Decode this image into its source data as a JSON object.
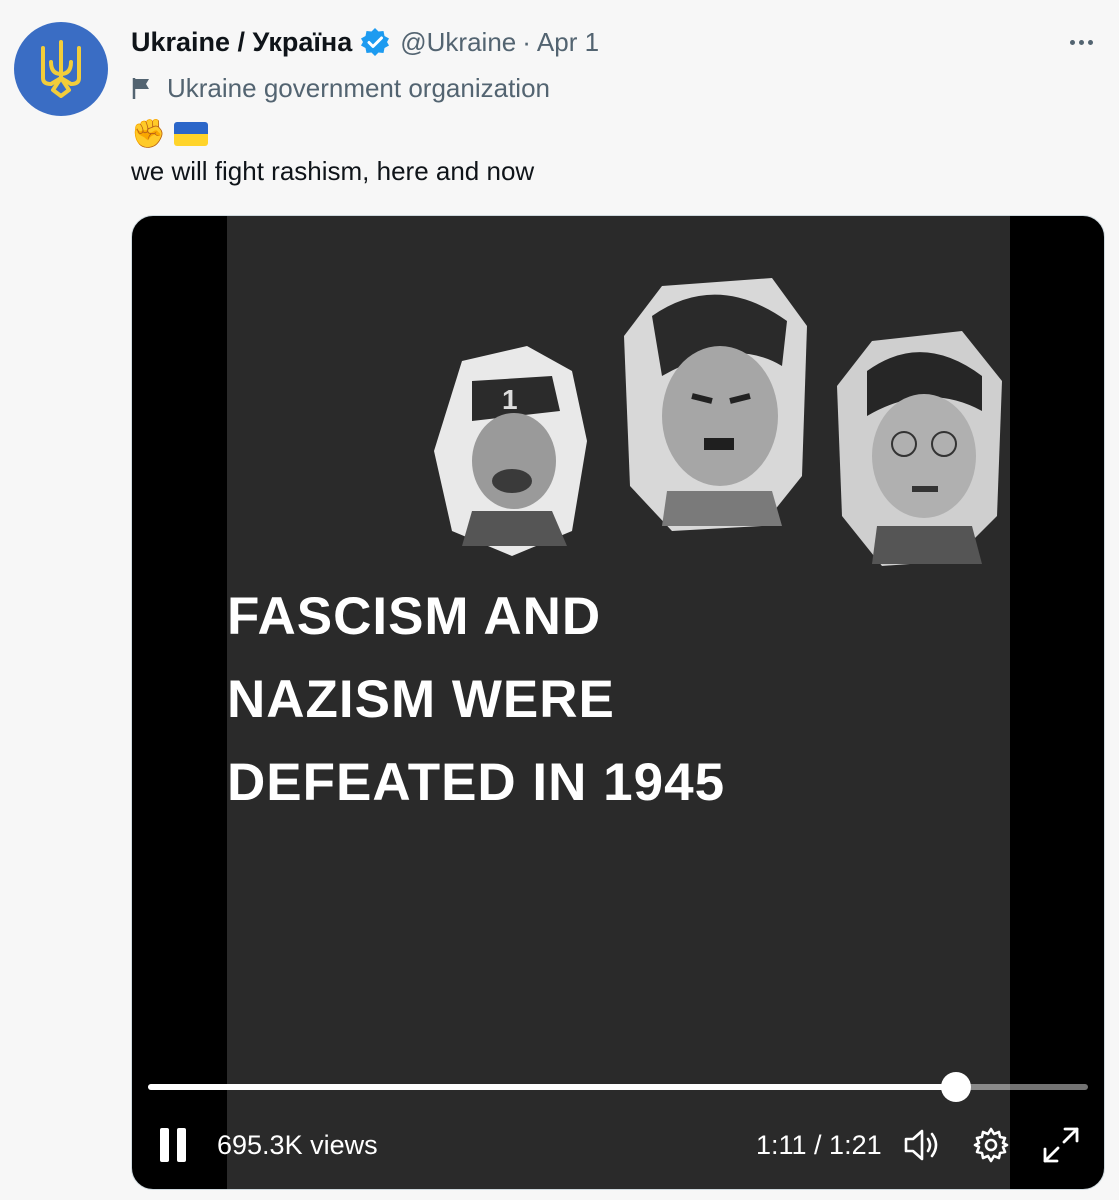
{
  "author": {
    "display_name": "Ukraine / Україна",
    "handle": "@Ukraine",
    "separator": "·",
    "date": "Apr 1",
    "verified": true,
    "label": "Ukraine government organization",
    "avatar_colors": {
      "background": "#3a6dc4",
      "emblem": "#f2cd3a"
    }
  },
  "tweet": {
    "emojis": [
      "fist-emoji",
      "ukraine-flag-emoji"
    ],
    "fist_glyph": "✊",
    "text": "we will fight rashism, here and now"
  },
  "video": {
    "caption": "FASCISM AND\nNAZISM WERE\nDEFEATED IN 1945",
    "views": "695.3K views",
    "time": "1:11 / 1:21",
    "progress_fraction": 0.86,
    "controls": [
      "pause-icon",
      "volume-icon",
      "settings-gear-icon",
      "fullscreen-icon"
    ]
  },
  "colors": {
    "accent_verified": "#1d9bf0",
    "secondary_text": "#536471",
    "flag_blue": "#2b66c9",
    "flag_yellow": "#ffd42a"
  }
}
